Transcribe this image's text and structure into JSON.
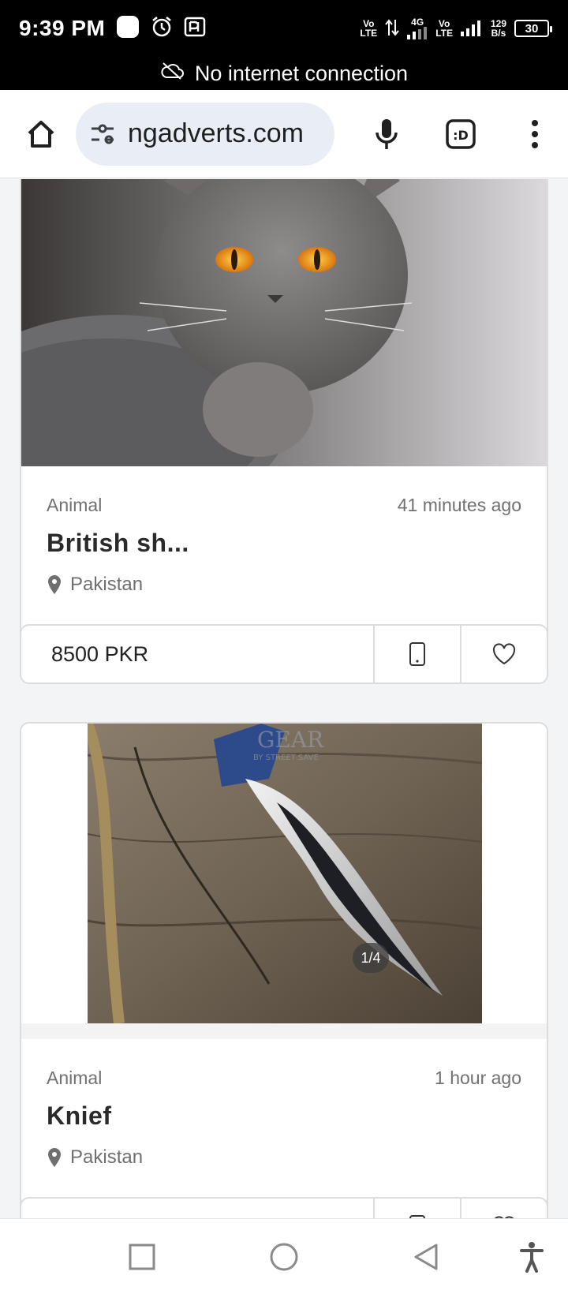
{
  "status_bar": {
    "time": "9:39 PM",
    "network_speed_value": "129",
    "network_speed_unit": "B/s",
    "battery": "30",
    "sim1_label_top": "Vo",
    "sim1_label_bottom": "LTE",
    "sim2_label_top": "Vo",
    "sim2_label_bottom": "LTE",
    "data_label": "4G"
  },
  "banner": {
    "text": "No internet connection"
  },
  "toolbar": {
    "url": "ngadverts.com",
    "tab_badge": ":D"
  },
  "listings": [
    {
      "category": "Animal",
      "time": "41 minutes ago",
      "title": "British sh...",
      "location": "Pakistan",
      "price": "8500 PKR"
    },
    {
      "category": "Animal",
      "time": "1 hour ago",
      "title": "Knief",
      "location": "Pakistan",
      "image_counter": "1/4",
      "image_watermark": "GEAR",
      "image_watermark_sub": "BY STREET SAVE"
    }
  ],
  "colors": {
    "banner_bg": "#000000",
    "omnibox_bg": "#e9eef6",
    "card_border": "#dcdcdc"
  }
}
